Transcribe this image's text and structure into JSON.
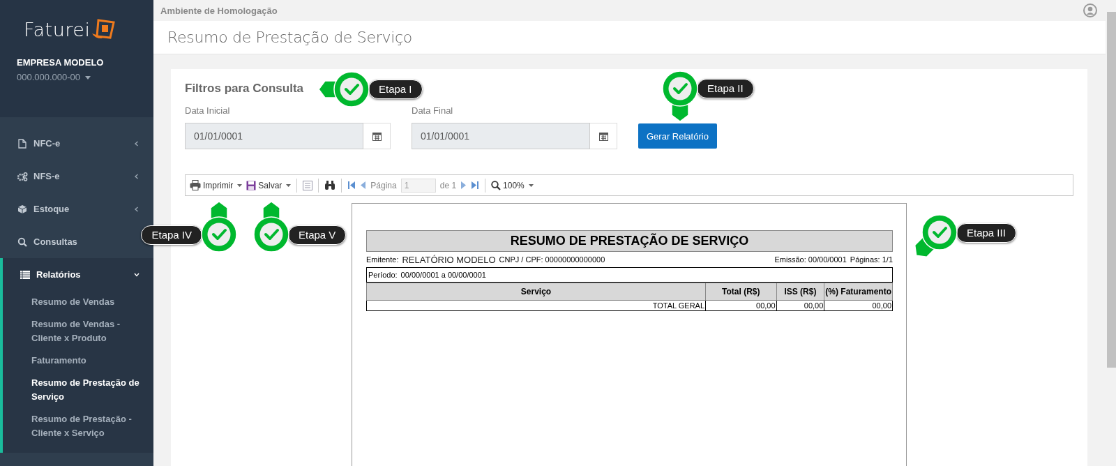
{
  "environment": "Ambiente de Homologação",
  "page_title": "Resumo de Prestação de Serviço",
  "sidebar": {
    "logo": "Faturei",
    "company": "EMPRESA MODELO",
    "company_id": "000.000.000-00",
    "items": [
      {
        "label": "NFC-e",
        "expanded": false,
        "selected": false
      },
      {
        "label": "NFS-e",
        "expanded": false,
        "selected": false
      },
      {
        "label": "Estoque",
        "expanded": false,
        "selected": false
      },
      {
        "label": "Consultas",
        "selected": false
      },
      {
        "label": "Relatórios",
        "expanded": true,
        "selected": true,
        "children": [
          {
            "label": "Resumo de Vendas",
            "selected": false
          },
          {
            "label": "Resumo de Vendas - Cliente x Produto",
            "selected": false
          },
          {
            "label": "Faturamento",
            "selected": false
          },
          {
            "label": "Resumo de Prestação de Serviço",
            "selected": true
          },
          {
            "label": "Resumo de Prestação - Cliente x Serviço",
            "selected": false
          }
        ]
      }
    ]
  },
  "filters": {
    "title": "Filtros para Consulta",
    "fields": [
      {
        "label": "Data Inicial",
        "value": "01/01/0001"
      },
      {
        "label": "Data Final",
        "value": "01/01/0001"
      }
    ],
    "button": "Gerar Relatório"
  },
  "viewer_toolbar": {
    "print": "Imprimir",
    "save": "Salvar",
    "page_label": "Página",
    "page": "1",
    "page_of": "de 1",
    "zoom": "100%"
  },
  "report": {
    "title": "RESUMO DE PRESTAÇÃO DE SERVIÇO",
    "issuer_label": "Emitente:",
    "issuer": "RELATÓRIO MODELO",
    "tax_id": "CNPJ / CPF: 00000000000000",
    "issued": "Emissão: 00/00/0001",
    "pages": "Páginas: 1/1",
    "period_label": "Período:",
    "period": "00/00/0001 a 00/00/0001",
    "columns": [
      "Serviço",
      "Total (R$)",
      "ISS (R$)",
      "(%) Faturamento"
    ],
    "total_row": [
      "TOTAL GERAL",
      "00,00",
      "00,00",
      "00,00"
    ]
  },
  "steps": [
    {
      "label": "Etapa I"
    },
    {
      "label": "Etapa II"
    },
    {
      "label": "Etapa IV"
    },
    {
      "label": "Etapa V"
    },
    {
      "label": "Etapa III"
    }
  ]
}
